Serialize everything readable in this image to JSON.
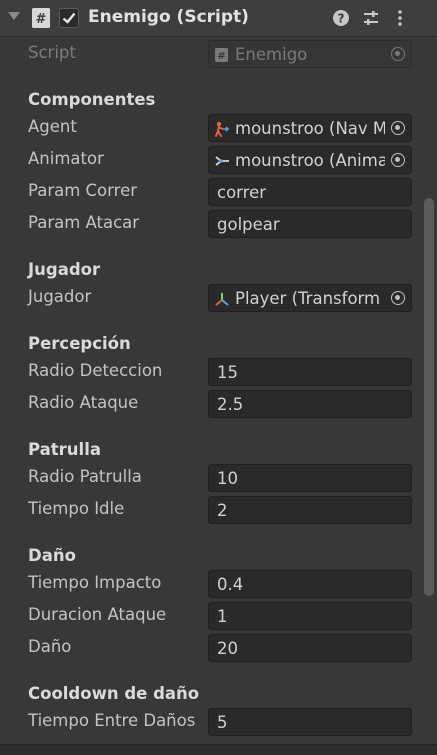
{
  "header": {
    "title": "Enemigo (Script)",
    "enabled": true
  },
  "script_row": {
    "label": "Script",
    "value": "Enemigo"
  },
  "sections": {
    "componentes": "Componentes",
    "jugador": "Jugador",
    "percepcion": "Percepción",
    "patrulla": "Patrulla",
    "dano": "Daño",
    "cooldown": "Cooldown de daño"
  },
  "fields": {
    "agent": {
      "label": "Agent",
      "value": "mounstroo (Nav M"
    },
    "animator": {
      "label": "Animator",
      "value": "mounstroo (Anima"
    },
    "param_correr": {
      "label": "Param Correr",
      "value": "correr"
    },
    "param_atacar": {
      "label": "Param Atacar",
      "value": "golpear"
    },
    "jugador": {
      "label": "Jugador",
      "value": "Player (Transform"
    },
    "radio_deteccion": {
      "label": "Radio Deteccion",
      "value": "15"
    },
    "radio_ataque": {
      "label": "Radio Ataque",
      "value": "2.5"
    },
    "radio_patrulla": {
      "label": "Radio Patrulla",
      "value": "10"
    },
    "tiempo_idle": {
      "label": "Tiempo Idle",
      "value": "2"
    },
    "tiempo_impacto": {
      "label": "Tiempo Impacto",
      "value": "0.4"
    },
    "duracion_ataque": {
      "label": "Duracion Ataque",
      "value": "1"
    },
    "dano": {
      "label": "Daño",
      "value": "20"
    },
    "tiempo_entre_danos": {
      "label": "Tiempo Entre Daños",
      "value": "5"
    }
  },
  "icons": {
    "fold": "foldout-arrow-icon",
    "script": "script-hash-icon",
    "help": "help-icon",
    "presets": "presets-icon",
    "menu": "kebab-menu-icon",
    "agent": "nav-mesh-agent-icon",
    "animator": "animator-icon",
    "transform": "transform-icon",
    "picker": "object-picker-icon"
  },
  "colors": {
    "background": "#383838",
    "field": "#2a2a2a",
    "text": "#d2d2d2",
    "dim_text": "#7c7c7c"
  }
}
